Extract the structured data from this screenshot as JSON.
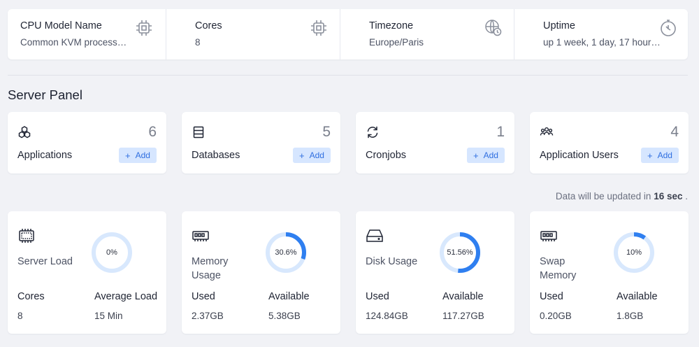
{
  "info": [
    {
      "title": "CPU Model Name",
      "value": "Common KVM process…",
      "icon": "cpu-chip-icon"
    },
    {
      "title": "Cores",
      "value": "8",
      "icon": "cpu-chip-icon"
    },
    {
      "title": "Timezone",
      "value": "Europe/Paris",
      "icon": "globe-clock-icon"
    },
    {
      "title": "Uptime",
      "value": "up 1 week, 1 day, 17 hour…",
      "icon": "stopwatch-icon"
    }
  ],
  "section_title": "Server Panel",
  "counters": [
    {
      "label": "Applications",
      "count": "6",
      "add_label": "Add",
      "icon": "cubes-icon"
    },
    {
      "label": "Databases",
      "count": "5",
      "add_label": "Add",
      "icon": "database-icon"
    },
    {
      "label": "Cronjobs",
      "count": "1",
      "add_label": "Add",
      "icon": "refresh-icon"
    },
    {
      "label": "Application Users",
      "count": "4",
      "add_label": "Add",
      "icon": "users-icon"
    }
  ],
  "update_note": {
    "prefix": "Data will be updated in ",
    "value": "16 sec",
    "suffix": " ."
  },
  "metrics": [
    {
      "title": "Server Load",
      "percent_label": "0%",
      "fraction": 0.0,
      "left_head": "Cores",
      "left_value": "8",
      "right_head": "Average Load",
      "right_value": "15 Min",
      "icon": "cpu-board-icon"
    },
    {
      "title": "Memory Usage",
      "percent_label": "30.6%",
      "fraction": 0.306,
      "left_head": "Used",
      "left_value": "2.37GB",
      "right_head": "Available",
      "right_value": "5.38GB",
      "icon": "ram-icon"
    },
    {
      "title": "Disk Usage",
      "percent_label": "51.56%",
      "fraction": 0.5156,
      "left_head": "Used",
      "left_value": "124.84GB",
      "right_head": "Available",
      "right_value": "117.27GB",
      "icon": "hard-drive-icon"
    },
    {
      "title": "Swap Memory",
      "percent_label": "10%",
      "fraction": 0.1,
      "left_head": "Used",
      "left_value": "0.20GB",
      "right_head": "Available",
      "right_value": "1.8GB",
      "icon": "ram-icon"
    }
  ],
  "colors": {
    "accent": "#2f7ff0",
    "ring_track": "#d8e8fd",
    "add_bg": "#d6e6ff",
    "add_text": "#2f6fe0"
  }
}
